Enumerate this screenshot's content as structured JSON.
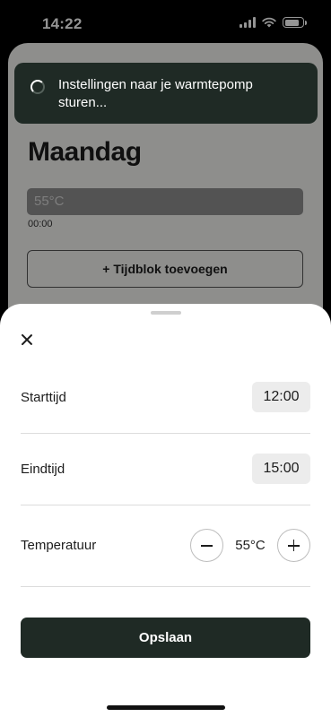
{
  "status_bar": {
    "time": "14:22"
  },
  "background_page": {
    "title": "Maandag",
    "temperature_block": "55°C",
    "time_marker": "00:00",
    "add_block_label": "+ Tijdblok toevoegen"
  },
  "toast": {
    "message": "Instellingen naar je warmtepomp sturen..."
  },
  "sheet": {
    "start": {
      "label": "Starttijd",
      "value": "12:00"
    },
    "end": {
      "label": "Eindtijd",
      "value": "15:00"
    },
    "temperature": {
      "label": "Temperatuur",
      "value": "55°C"
    },
    "save_label": "Opslaan"
  },
  "colors": {
    "dark_accent": "#1f2a25",
    "chip_bg": "#ececec"
  },
  "icons": [
    "signal-icon",
    "wifi-icon",
    "battery-icon",
    "spinner-icon",
    "close-icon",
    "minus-icon",
    "plus-icon"
  ]
}
